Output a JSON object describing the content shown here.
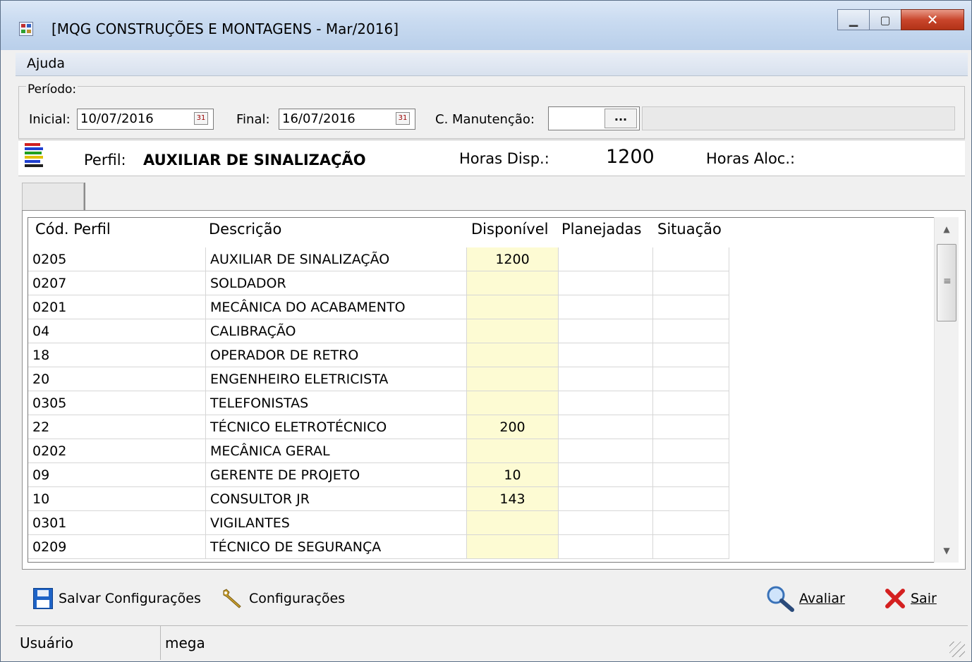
{
  "window": {
    "title": "[MQG CONSTRUÇÕES E MONTAGENS - Mar/2016]"
  },
  "menu": {
    "items": [
      "Ajuda"
    ]
  },
  "period": {
    "legend": "Período:",
    "initial_label": "Inicial:",
    "initial_value": "10/07/2016",
    "final_label": "Final:",
    "final_value": "16/07/2016",
    "maint_label": "C. Manutenção:",
    "maint_value": "",
    "maint_button": "...",
    "maint_desc": ""
  },
  "profile": {
    "label": "Perfil:",
    "name": "AUXILIAR DE SINALIZAÇÃO",
    "hours_disp_label": "Horas Disp.:",
    "hours_disp_value": "1200",
    "hours_aloc_label": "Horas Aloc.:",
    "hours_aloc_value": ""
  },
  "tabs": [
    {
      "label": ""
    }
  ],
  "grid": {
    "columns": [
      "Cód. Perfil",
      "Descrição",
      "Disponível",
      "Planejadas",
      "Situação"
    ],
    "rows": [
      {
        "code": "0205",
        "desc": "AUXILIAR DE SINALIZAÇÃO",
        "disp": "1200",
        "plan": "",
        "sit": ""
      },
      {
        "code": "0207",
        "desc": "SOLDADOR",
        "disp": "",
        "plan": "",
        "sit": ""
      },
      {
        "code": "0201",
        "desc": "MECÂNICA DO ACABAMENTO",
        "disp": "",
        "plan": "",
        "sit": ""
      },
      {
        "code": "04",
        "desc": "CALIBRAÇÃO",
        "disp": "",
        "plan": "",
        "sit": ""
      },
      {
        "code": "18",
        "desc": "OPERADOR DE RETRO",
        "disp": "",
        "plan": "",
        "sit": ""
      },
      {
        "code": "20",
        "desc": "ENGENHEIRO ELETRICISTA",
        "disp": "",
        "plan": "",
        "sit": ""
      },
      {
        "code": "0305",
        "desc": "TELEFONISTAS",
        "disp": "",
        "plan": "",
        "sit": ""
      },
      {
        "code": "22",
        "desc": "TÉCNICO ELETROTÉCNICO",
        "disp": "200",
        "plan": "",
        "sit": ""
      },
      {
        "code": "0202",
        "desc": "MECÂNICA GERAL",
        "disp": "",
        "plan": "",
        "sit": ""
      },
      {
        "code": "09",
        "desc": "GERENTE DE PROJETO",
        "disp": "10",
        "plan": "",
        "sit": ""
      },
      {
        "code": "10",
        "desc": "CONSULTOR JR",
        "disp": "143",
        "plan": "",
        "sit": ""
      },
      {
        "code": "0301",
        "desc": "VIGILANTES",
        "disp": "",
        "plan": "",
        "sit": ""
      },
      {
        "code": "0209",
        "desc": "TÉCNICO DE SEGURANÇA",
        "disp": "",
        "plan": "",
        "sit": ""
      }
    ]
  },
  "toolbar": {
    "save_config": "Salvar Configurações",
    "config": "Configurações",
    "evaluate": "Avaliar",
    "exit": "Sair"
  },
  "status": {
    "user_label": "Usuário",
    "user_value": "mega"
  },
  "colors": {
    "available_cell_bg": "#fdfbd3",
    "close_button": "#c9462c",
    "save_icon": "#1e63c6",
    "exit_icon": "#d42020"
  }
}
